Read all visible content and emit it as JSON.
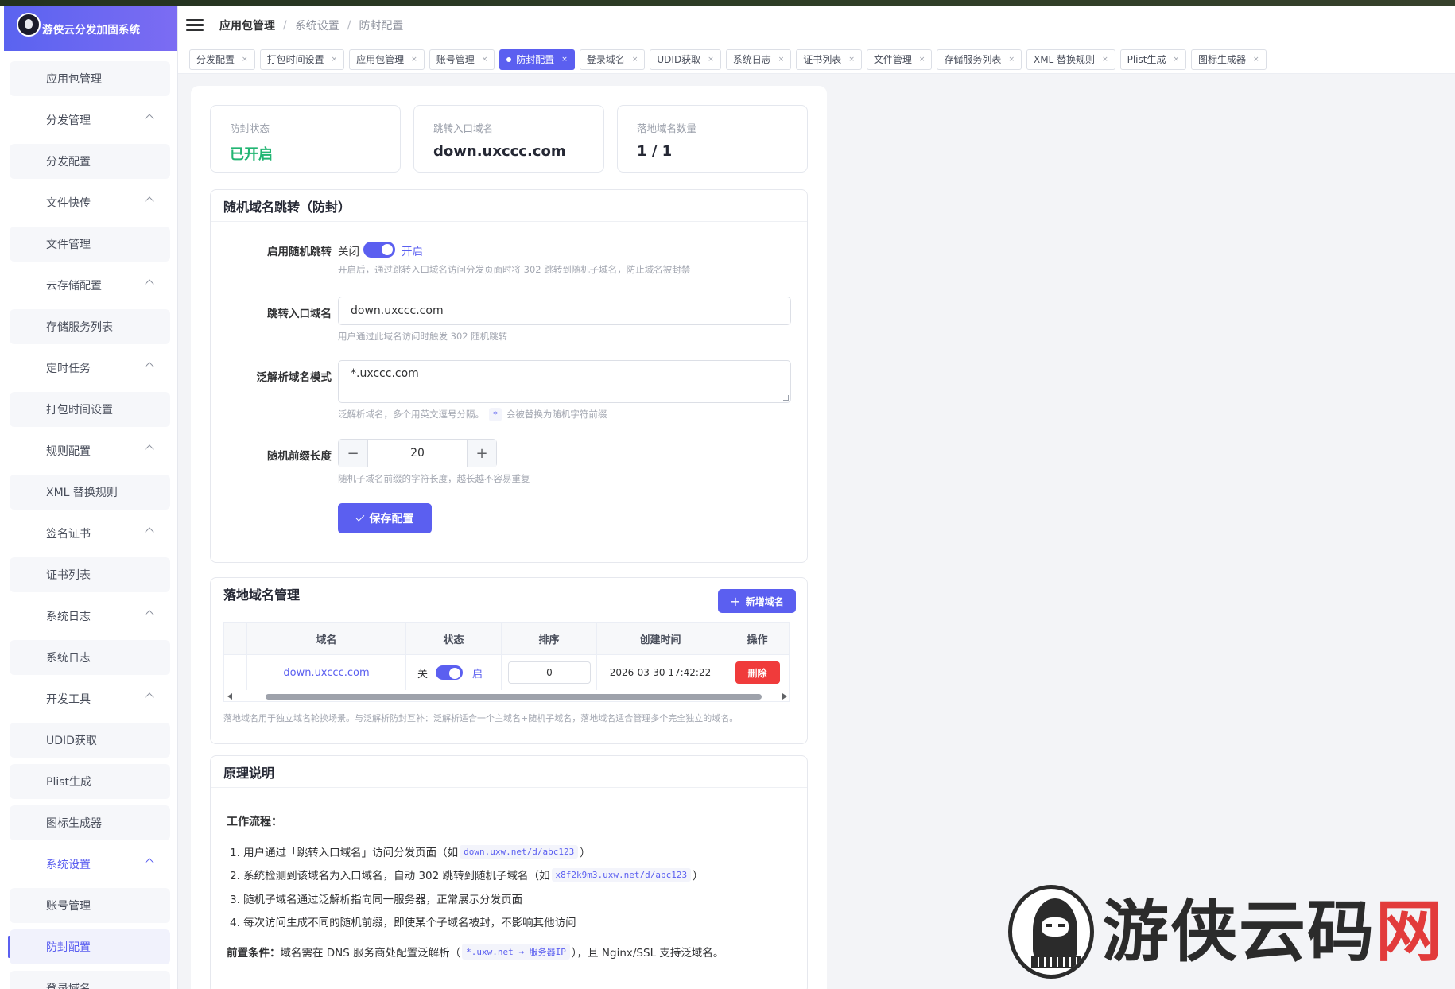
{
  "app": {
    "title": "游侠云分发加固系统"
  },
  "sidebar": {
    "items": [
      {
        "label": "应用包管理",
        "kind": "sub"
      },
      {
        "label": "分发管理",
        "kind": "group"
      },
      {
        "label": "分发配置",
        "kind": "sub"
      },
      {
        "label": "文件快传",
        "kind": "group"
      },
      {
        "label": "文件管理",
        "kind": "sub"
      },
      {
        "label": "云存储配置",
        "kind": "group"
      },
      {
        "label": "存储服务列表",
        "kind": "sub"
      },
      {
        "label": "定时任务",
        "kind": "group"
      },
      {
        "label": "打包时间设置",
        "kind": "sub"
      },
      {
        "label": "规则配置",
        "kind": "group"
      },
      {
        "label": "XML 替换规则",
        "kind": "sub"
      },
      {
        "label": "签名证书",
        "kind": "group"
      },
      {
        "label": "证书列表",
        "kind": "sub"
      },
      {
        "label": "系统日志",
        "kind": "group"
      },
      {
        "label": "系统日志",
        "kind": "sub"
      },
      {
        "label": "开发工具",
        "kind": "group"
      },
      {
        "label": "UDID获取",
        "kind": "sub"
      },
      {
        "label": "Plist生成",
        "kind": "sub"
      },
      {
        "label": "图标生成器",
        "kind": "sub"
      },
      {
        "label": "系统设置",
        "kind": "group"
      },
      {
        "label": "账号管理",
        "kind": "sub"
      },
      {
        "label": "防封配置",
        "kind": "sub"
      },
      {
        "label": "登录域名",
        "kind": "sub"
      }
    ]
  },
  "header": {
    "breadcrumb": [
      "应用包管理",
      "系统设置",
      "防封配置"
    ],
    "sep": "/"
  },
  "tabs": [
    {
      "label": "分发配置"
    },
    {
      "label": "打包时间设置"
    },
    {
      "label": "应用包管理"
    },
    {
      "label": "账号管理"
    },
    {
      "label": "防封配置",
      "active": true
    },
    {
      "label": "登录域名"
    },
    {
      "label": "UDID获取"
    },
    {
      "label": "系统日志"
    },
    {
      "label": "证书列表"
    },
    {
      "label": "文件管理"
    },
    {
      "label": "存储服务列表"
    },
    {
      "label": "XML 替换规则"
    },
    {
      "label": "Plist生成"
    },
    {
      "label": "图标生成器"
    }
  ],
  "tab_close": "×",
  "stats": [
    {
      "label": "防封状态",
      "value": "已开启"
    },
    {
      "label": "跳转入口域名",
      "value": "down.uxccc.com"
    },
    {
      "label": "落地域名数量",
      "value": "1 / 1"
    }
  ],
  "random_jump": {
    "title": "随机域名跳转（防封）",
    "enable_label": "启用随机跳转",
    "off_text": "关闭",
    "on_text": "开启",
    "enable_hint": "开启后，通过跳转入口域名访问分发页面时将 302 跳转到随机子域名，防止域名被封禁",
    "entry_label": "跳转入口域名",
    "entry_value": "down.uxccc.com",
    "entry_hint": "用户通过此域名访问时触发 302 随机跳转",
    "pattern_label": "泛解析域名模式",
    "pattern_value": "*.uxccc.com",
    "pattern_hint_a": "泛解析域名，多个用英文逗号分隔。",
    "pattern_hint_code": "*",
    "pattern_hint_b": "会被替换为随机字符前缀",
    "prefix_label": "随机前缀长度",
    "prefix_value": "20",
    "minus": "−",
    "plus": "+",
    "prefix_hint": "随机子域名前缀的字符长度，越长越不容易重复",
    "save_label": "保存配置"
  },
  "landing": {
    "title": "落地域名管理",
    "add_label": "新增域名",
    "add_plus": "+",
    "columns": [
      "域名",
      "状态",
      "排序",
      "创建时间",
      "操作"
    ],
    "rows": [
      {
        "domain": "down.uxccc.com",
        "off": "关",
        "on": "启",
        "sort": "0",
        "created": "2026-03-30 17:42:22",
        "action": "删除"
      }
    ],
    "hint": "落地域名用于独立域名轮换场景。与泛解析防封互补：泛解析适合一个主域名+随机子域名，落地域名适合管理多个完全独立的域名。"
  },
  "principle": {
    "title": "原理说明",
    "flow_title": "工作流程：",
    "steps": [
      {
        "a": "1. 用户通过「跳转入口域名」访问分发页面（如",
        "code": "down.uxw.net/d/abc123",
        "b": "）"
      },
      {
        "a": "2. 系统检测到该域名为入口域名，自动 302 跳转到随机子域名（如",
        "code": "x8f2k9m3.uxw.net/d/abc123",
        "b": "）"
      },
      {
        "a": "3. 随机子域名通过泛解析指向同一服务器，正常展示分发页面",
        "code": "",
        "b": ""
      },
      {
        "a": "4. 每次访问生成不同的随机前缀，即使某个子域名被封，不影响其他访问",
        "code": "",
        "b": ""
      }
    ],
    "pre_label": "前置条件：",
    "pre_a": "域名需在 DNS 服务商处配置泛解析（",
    "pre_code": "*.uxw.net → 服务器IP",
    "pre_b": "），且 Nginx/SSL 支持泛域名。"
  },
  "watermark": {
    "text_a": "游侠云码",
    "text_b": "网"
  },
  "colors": {
    "accent": "#5b5ff0",
    "success": "#22b573",
    "danger": "#f03b3b"
  }
}
